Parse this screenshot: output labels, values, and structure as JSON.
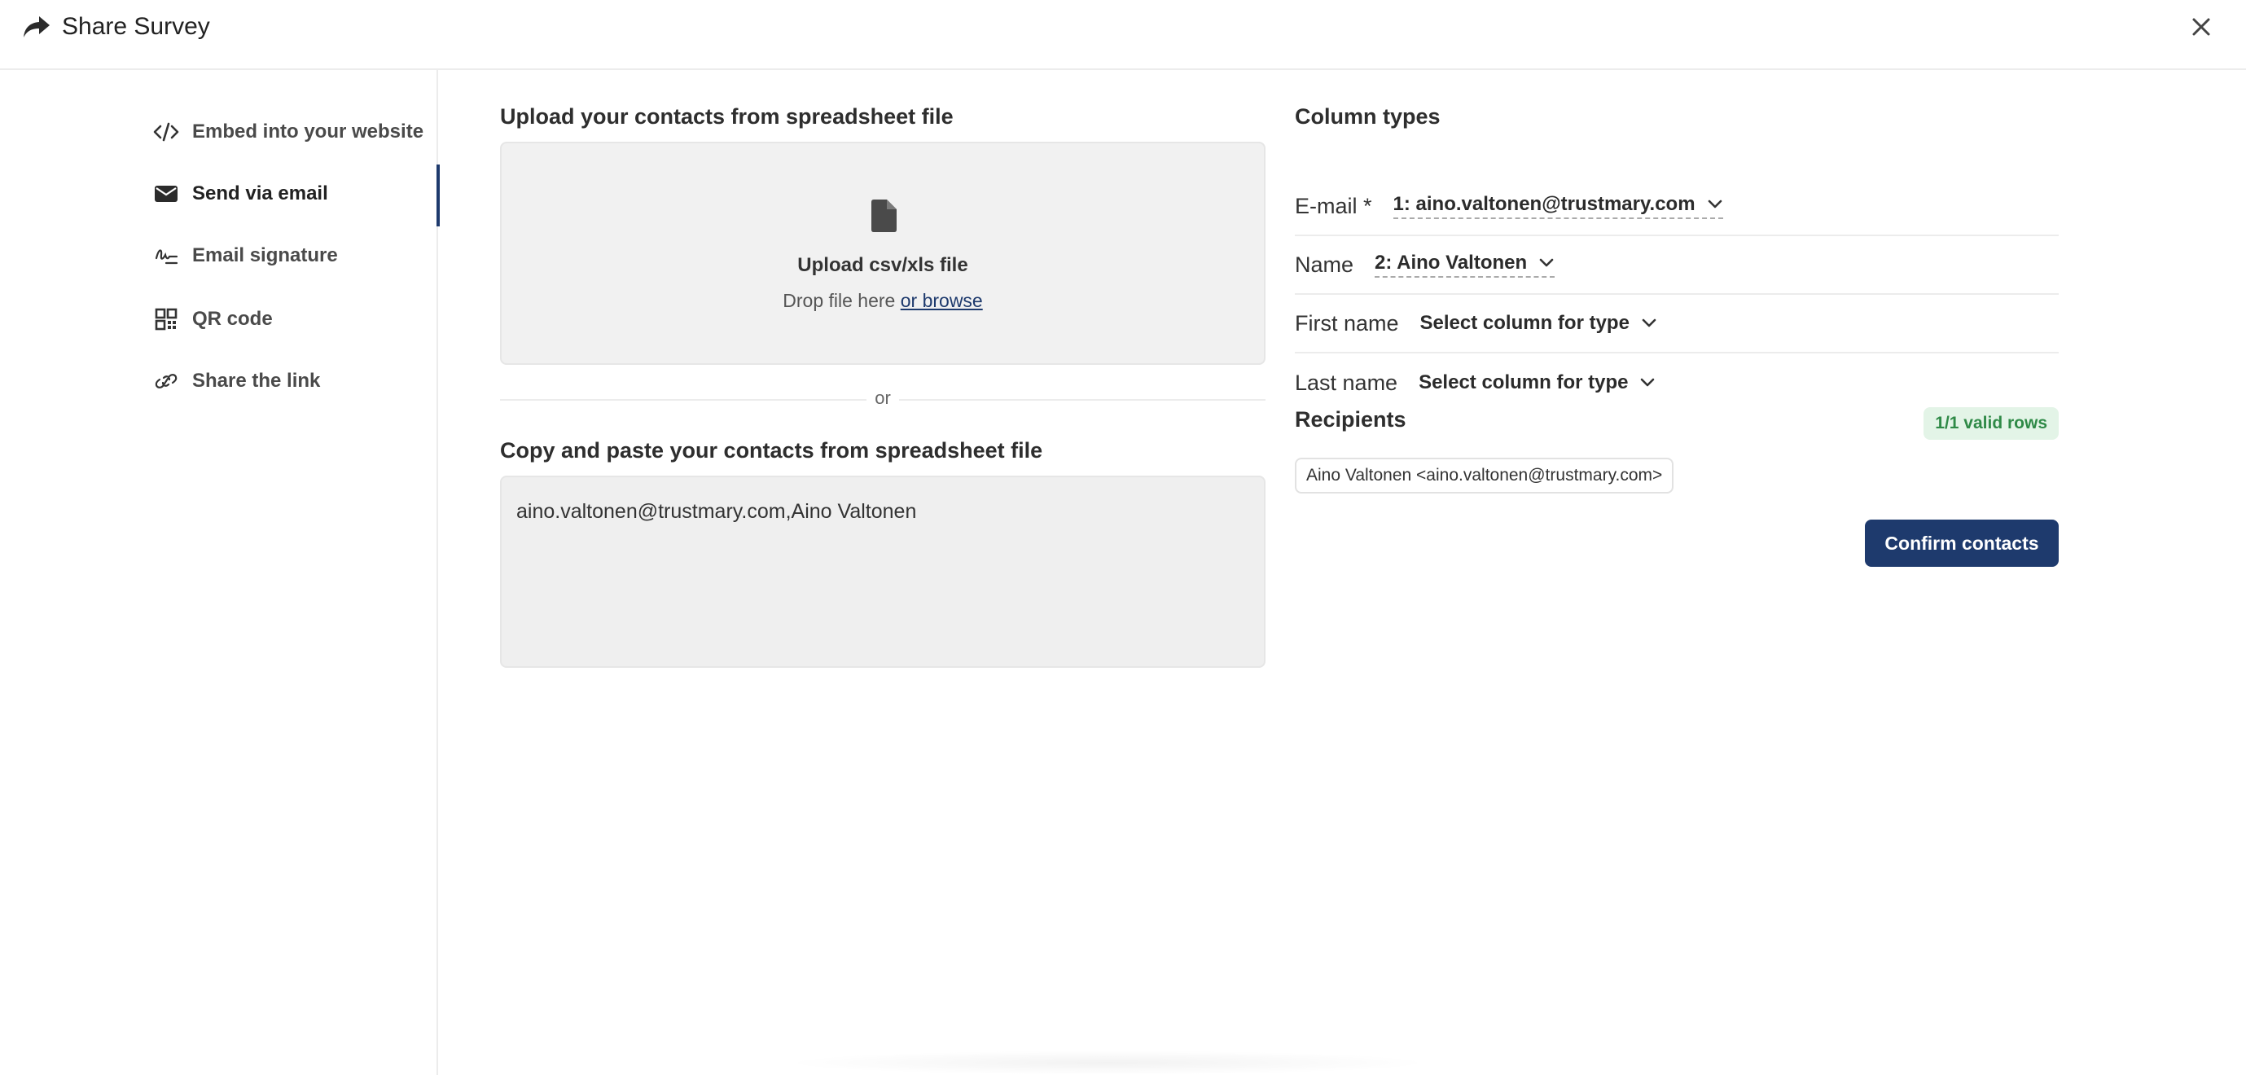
{
  "header": {
    "title": "Share Survey",
    "share_icon": "share-arrow-icon",
    "close_icon": "close-icon"
  },
  "sidebar": {
    "items": [
      {
        "label": "Embed into your website",
        "icon": "code-icon",
        "active": false
      },
      {
        "label": "Send via email",
        "icon": "envelope-icon",
        "active": true
      },
      {
        "label": "Email signature",
        "icon": "signature-icon",
        "active": false
      },
      {
        "label": "QR code",
        "icon": "qr-code-icon",
        "active": false
      },
      {
        "label": "Share the link",
        "icon": "link-icon",
        "active": false
      }
    ]
  },
  "upload": {
    "section_title": "Upload your contacts from spreadsheet file",
    "box_title": "Upload csv/xls file",
    "drop_text": "Drop file here ",
    "browse_link": "or browse",
    "or_text": "or"
  },
  "paste": {
    "section_title": "Copy and paste your contacts from spreadsheet file",
    "value": "aino.valtonen@trustmary.com,Aino Valtonen"
  },
  "column_types": {
    "title": "Column types",
    "rows": [
      {
        "label": "E-mail *",
        "selected": "1: aino.valtonen@trustmary.com"
      },
      {
        "label": "Name",
        "selected": "2: Aino Valtonen"
      },
      {
        "label": "First name",
        "selected": "Select column for type"
      },
      {
        "label": "Last name",
        "selected": "Select column for type"
      }
    ]
  },
  "recipients": {
    "title": "Recipients",
    "valid_badge": "1/1 valid rows",
    "chips": [
      "Aino Valtonen <aino.valtonen@trustmary.com>"
    ],
    "confirm_label": "Confirm contacts"
  },
  "colors": {
    "accent": "#1e3a6d",
    "success_text": "#2f8a47",
    "success_bg": "#e3f4e7"
  }
}
